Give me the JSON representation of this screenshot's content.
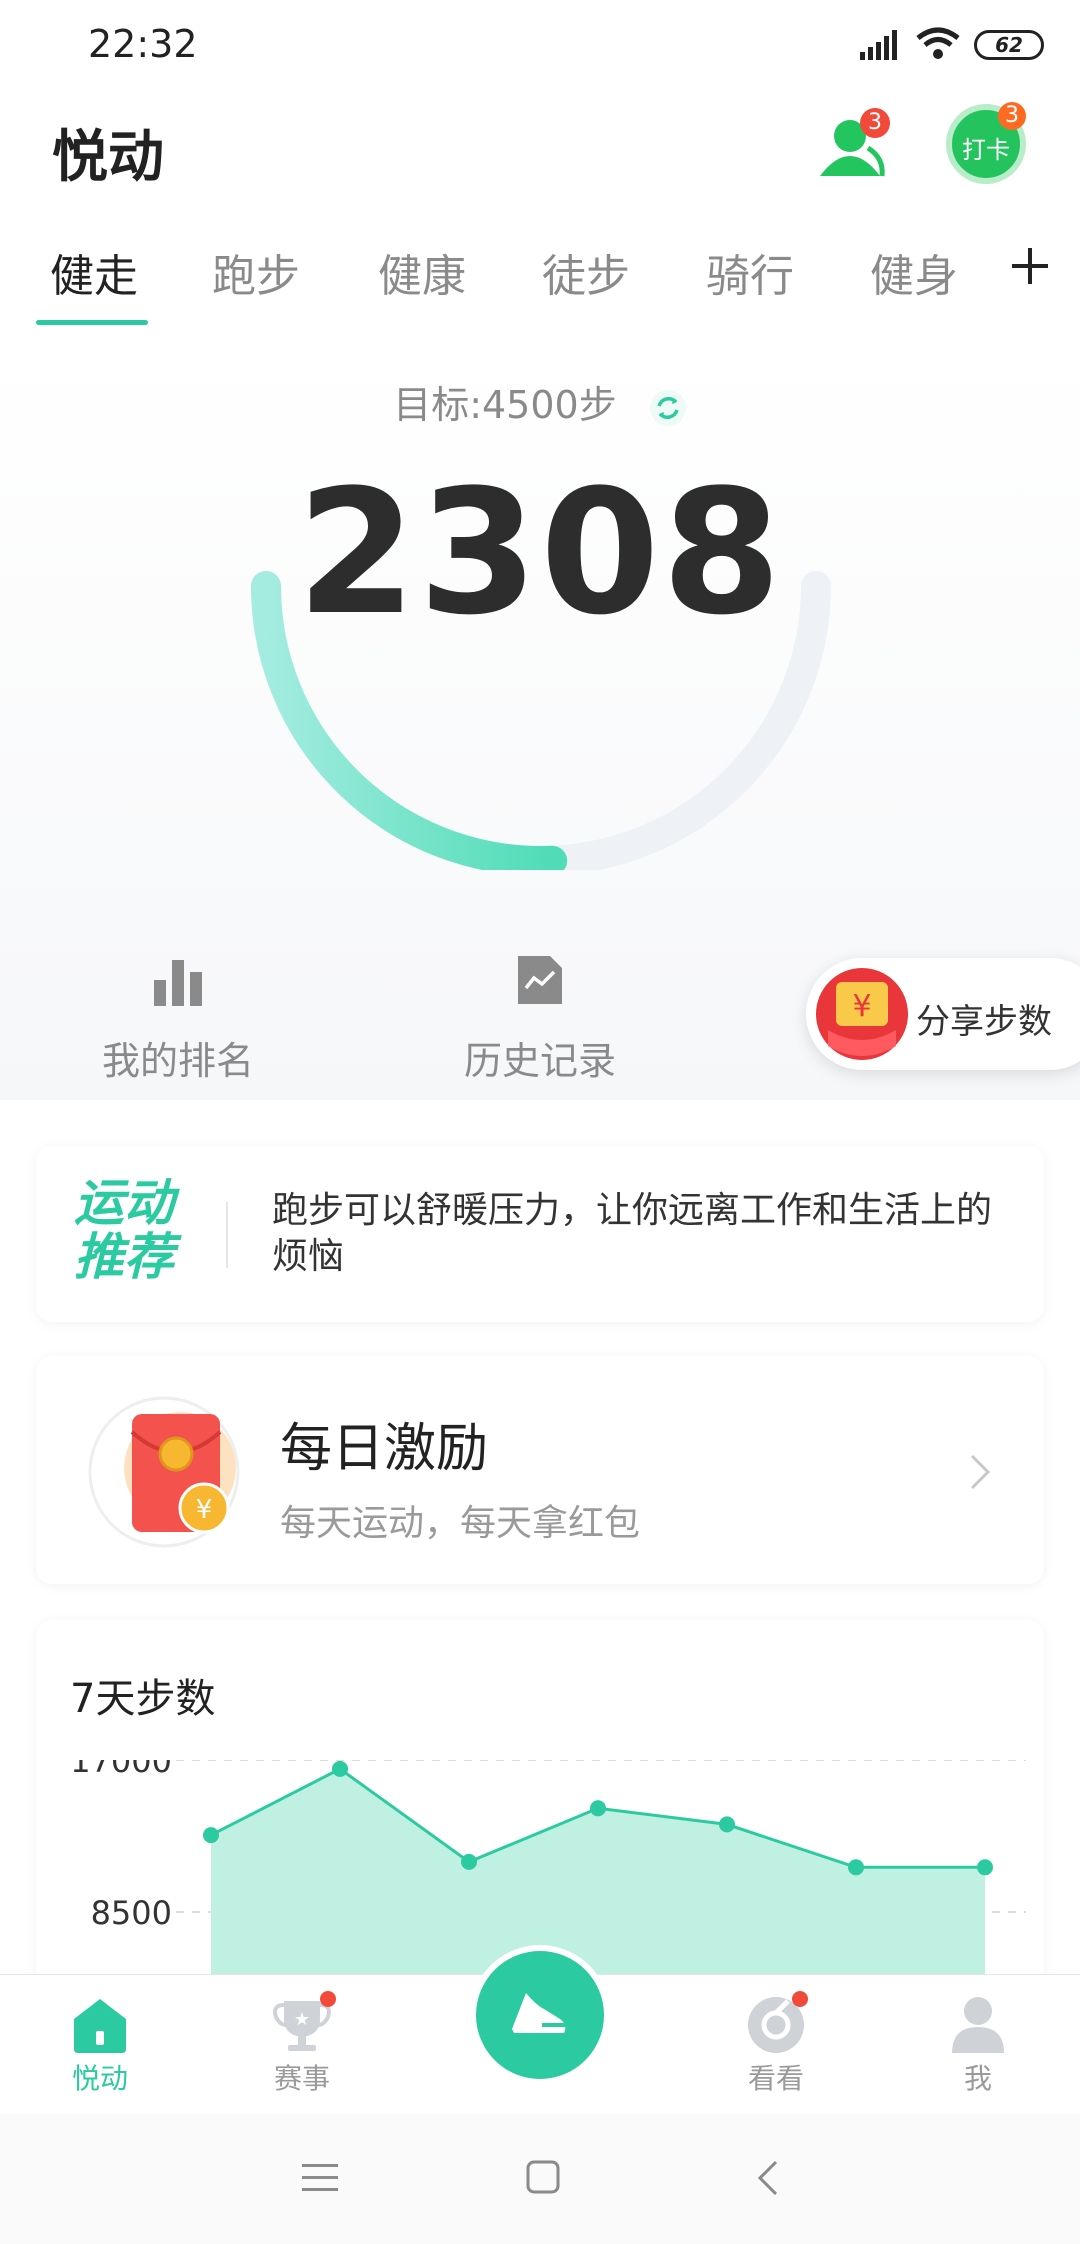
{
  "status_bar": {
    "time": "22:32",
    "battery": "62"
  },
  "header": {
    "title": "悦动",
    "friends_badge": "3",
    "checkin_label": "打卡",
    "checkin_badge": "3"
  },
  "tabs": [
    {
      "label": "健走",
      "active": true
    },
    {
      "label": "跑步"
    },
    {
      "label": "健康"
    },
    {
      "label": "徒步"
    },
    {
      "label": "骑行"
    },
    {
      "label": "健身"
    }
  ],
  "add_tab_icon": "plus-icon",
  "hero": {
    "goal_label": "目标:4500步",
    "steps": "2308",
    "progress_fraction": 0.513
  },
  "quick_actions": {
    "ranking": "我的排名",
    "history": "历史记录",
    "share": "分享步数"
  },
  "recommendation": {
    "title_line1": "运动",
    "title_line2": "推荐",
    "text": "跑步可以舒暖压力，让你远离工作和生活上的烦恼"
  },
  "daily_reward": {
    "title": "每日激励",
    "subtitle": "每天运动，每天拿红包"
  },
  "weekly_chart": {
    "title": "7天步数"
  },
  "chart_data": {
    "type": "area",
    "title": "7天步数",
    "yticks": [
      "17000",
      "8500"
    ],
    "ylim": [
      0,
      17000
    ],
    "values": [
      12800,
      16500,
      11300,
      14300,
      13400,
      11000,
      11000
    ],
    "color": "#2ccaa0"
  },
  "bottom_nav": {
    "home": "悦动",
    "events": "赛事",
    "watch": "看看",
    "me": "我"
  },
  "colors": {
    "accent": "#2ccaa0",
    "badge": "#f24a3a"
  }
}
